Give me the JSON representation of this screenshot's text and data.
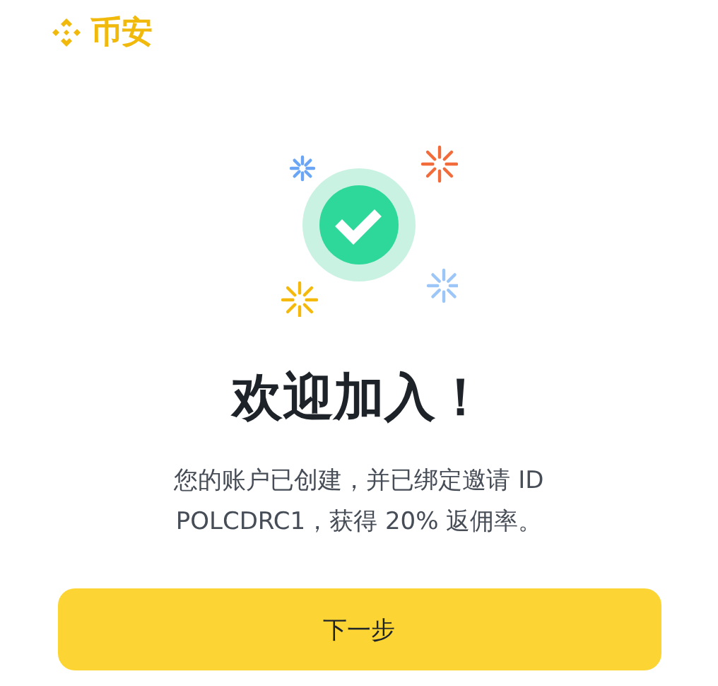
{
  "brand": {
    "name": "币安"
  },
  "title": "欢迎加入！",
  "message": "您的账户已创建，并已绑定邀请 ID POLCDRC1，获得 20% 返佣率。",
  "button": {
    "label": "下一步"
  }
}
